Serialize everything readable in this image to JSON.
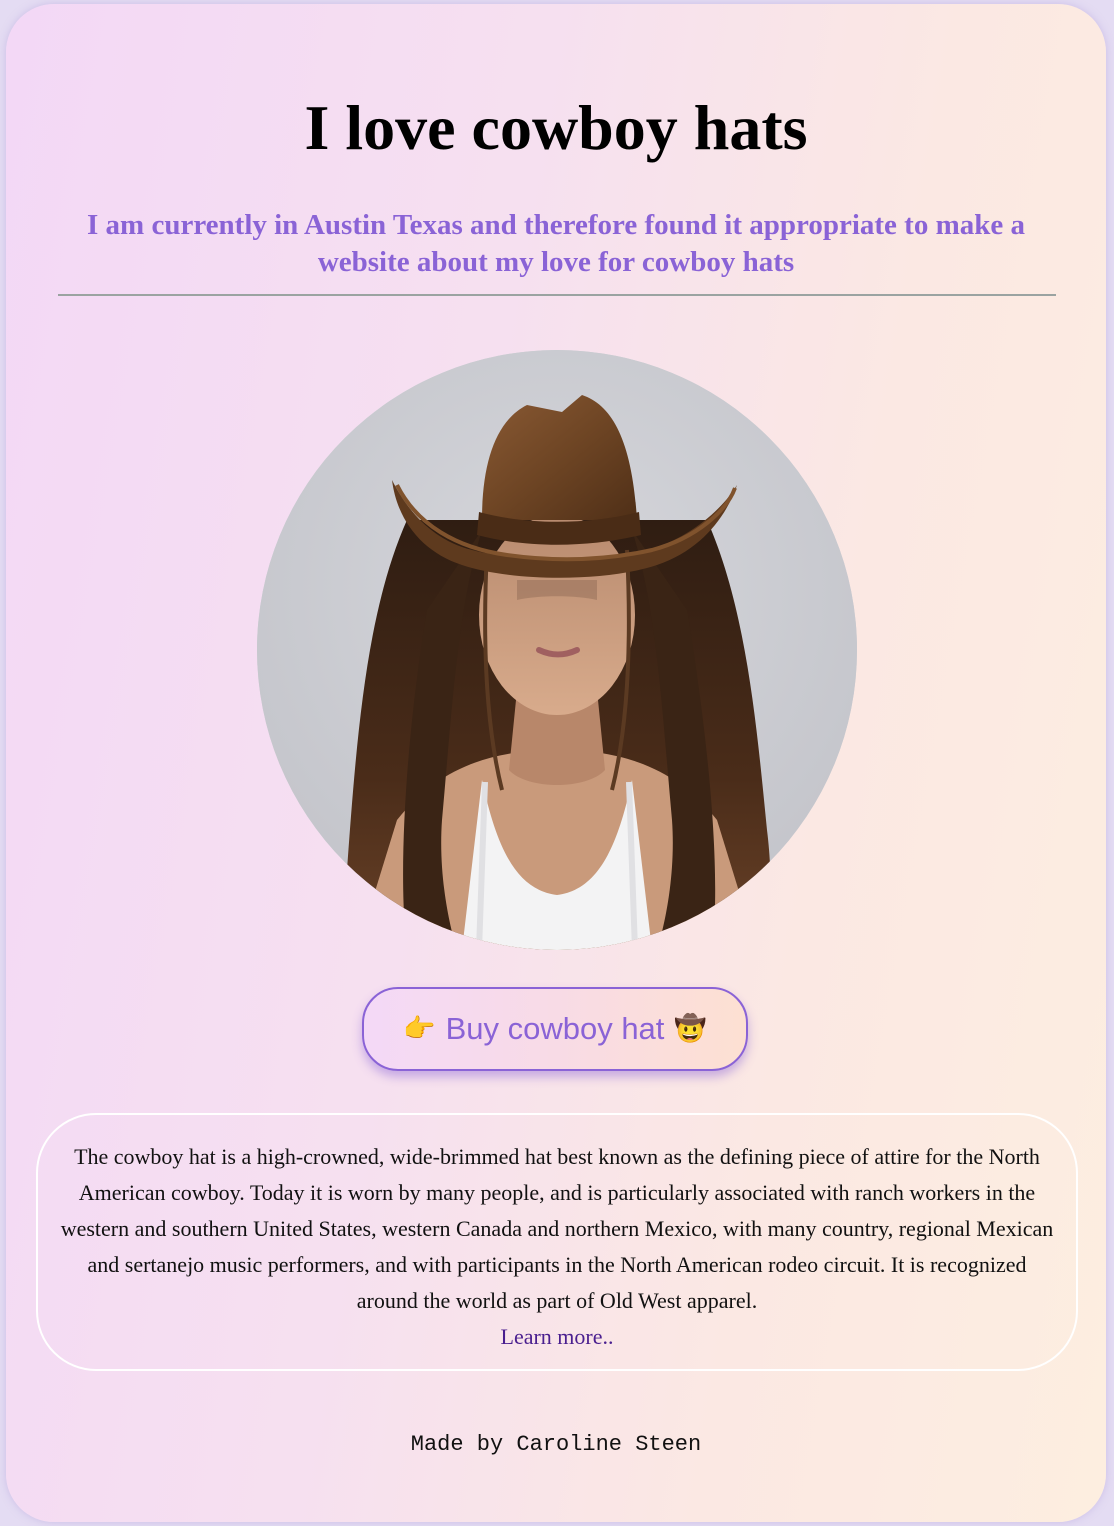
{
  "page": {
    "title": "I love cowboy hats",
    "subtitle": "I am currently in Austin Texas and therefore found it appropriate to make a website about my love for cowboy hats"
  },
  "image": {
    "icon": "woman-in-cowboy-hat-photo"
  },
  "buy_button": {
    "label": "Buy cowboy hat",
    "leading_emoji": "👉",
    "trailing_emoji": "🤠"
  },
  "info": {
    "text": "The cowboy hat is a high-crowned, wide-brimmed hat best known as the defining piece of attire for the North American cowboy. Today it is worn by many people, and is particularly associated with ranch workers in the western and southern United States, western Canada and northern Mexico, with many country, regional Mexican and sertanejo music performers, and with participants in the North American rodeo circuit. It is recognized around the world as part of Old West apparel.",
    "link_label": "Learn more.."
  },
  "footer": {
    "text": "Made by Caroline Steen"
  },
  "colors": {
    "accent": "#8a63d6",
    "link": "#4a1f8f",
    "rule": "#9aa3a1"
  }
}
